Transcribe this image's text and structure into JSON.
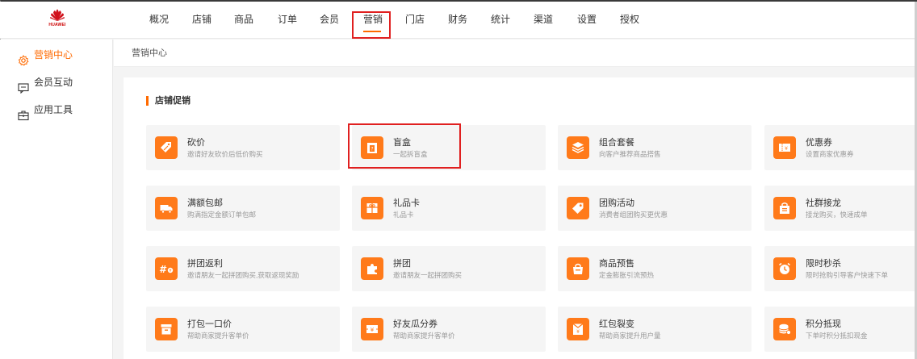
{
  "brand": {
    "logo_text": "HUAWEI",
    "accent": "#ff6a00",
    "highlight": "#e02020"
  },
  "topnav": {
    "items": [
      {
        "label": "概况"
      },
      {
        "label": "店铺"
      },
      {
        "label": "商品"
      },
      {
        "label": "订单"
      },
      {
        "label": "会员"
      },
      {
        "label": "营销",
        "active": true
      },
      {
        "label": "门店"
      },
      {
        "label": "财务"
      },
      {
        "label": "统计"
      },
      {
        "label": "渠道"
      },
      {
        "label": "设置"
      },
      {
        "label": "授权"
      }
    ]
  },
  "sidebar": {
    "items": [
      {
        "label": "营销中心",
        "icon": "gear-icon",
        "active": true
      },
      {
        "label": "会员互动",
        "icon": "chat-icon"
      },
      {
        "label": "应用工具",
        "icon": "toolbox-icon"
      }
    ]
  },
  "breadcrumb": {
    "label": "营销中心"
  },
  "section": {
    "title": "店铺促销"
  },
  "cards": [
    {
      "title": "砍价",
      "desc": "邀请好友砍价后低价购买",
      "icon": "tag-percent-icon"
    },
    {
      "title": "盲盒",
      "desc": "一起拆盲盒",
      "icon": "blind-box-icon",
      "highlighted": true
    },
    {
      "title": "组合套餐",
      "desc": "向客户推荐商品搭售",
      "icon": "layers-icon"
    },
    {
      "title": "优惠券",
      "desc": "设置商家优惠券",
      "icon": "coupon-icon"
    },
    {
      "title": "满额包邮",
      "desc": "购满指定金额订单包邮",
      "icon": "truck-icon"
    },
    {
      "title": "礼品卡",
      "desc": "礼品卡",
      "icon": "gift-card-icon"
    },
    {
      "title": "团购活动",
      "desc": "消费者组团购买更优惠",
      "icon": "price-tag-icon"
    },
    {
      "title": "社群接龙",
      "desc": "接龙购买，快速成单",
      "icon": "community-bag-icon"
    },
    {
      "title": "拼团返利",
      "desc": "邀请朋友一起拼团购买,获取返现奖励",
      "icon": "group-rebate-icon"
    },
    {
      "title": "拼团",
      "desc": "邀请朋友一起拼团购买",
      "icon": "puzzle-icon"
    },
    {
      "title": "商品预售",
      "desc": "定金膨胀引流预热",
      "icon": "presale-bag-icon"
    },
    {
      "title": "限时秒杀",
      "desc": "限时抢购引导客户快速下单",
      "icon": "alarm-clock-icon"
    },
    {
      "title": "打包一口价",
      "desc": "帮助商家提升客单价",
      "icon": "package-box-icon"
    },
    {
      "title": "好友瓜分券",
      "desc": "帮助商家提升客单价",
      "icon": "split-coupon-icon"
    },
    {
      "title": "红包裂变",
      "desc": "帮助商家提升用户量",
      "icon": "red-envelope-icon"
    },
    {
      "title": "积分抵现",
      "desc": "下单时积分抵扣现金",
      "icon": "coins-icon"
    }
  ]
}
